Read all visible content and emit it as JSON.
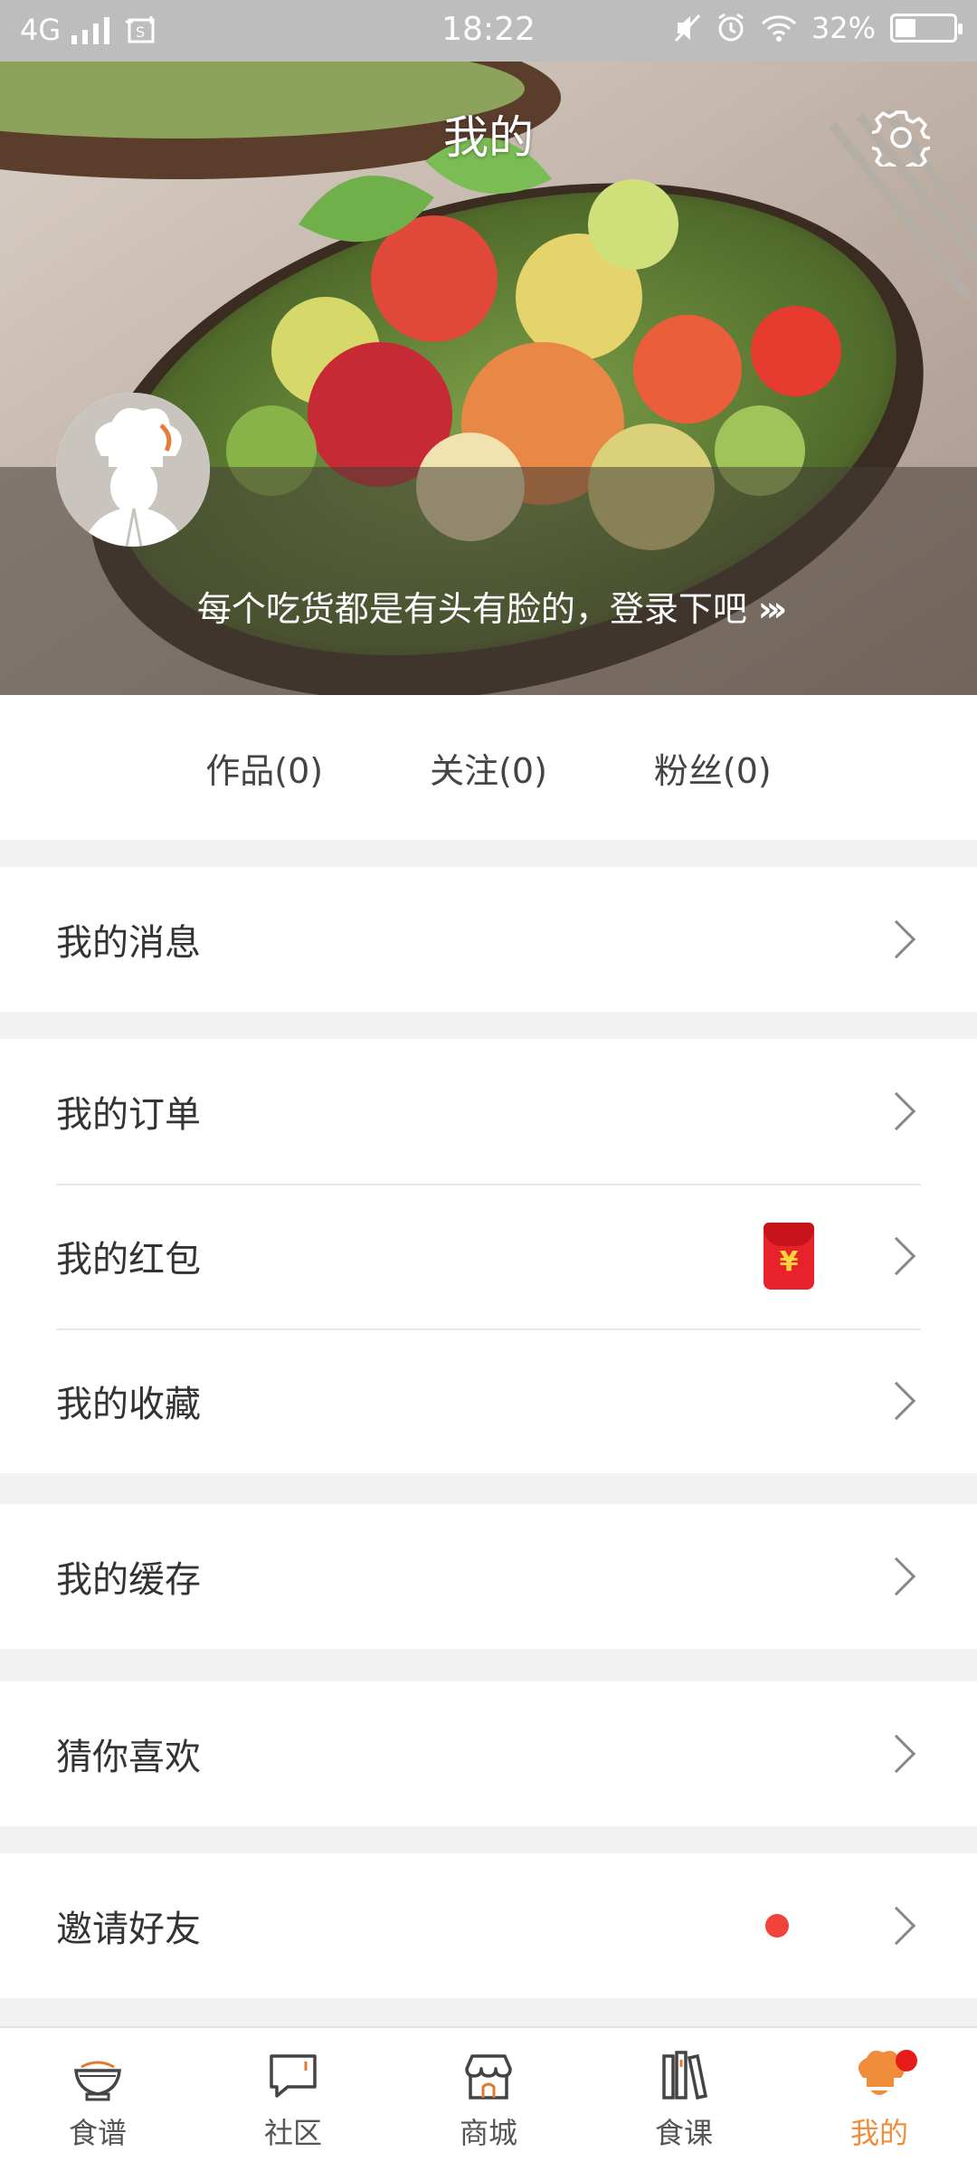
{
  "status_bar": {
    "network": "4G",
    "time": "18:22",
    "battery": "32%"
  },
  "header": {
    "title": "我的"
  },
  "profile": {
    "login_tip": "每个吃货都是有头有脸的，登录下吧",
    "login_arrow": "»›"
  },
  "stats": {
    "works": "作品(0)",
    "following": "关注(0)",
    "fans": "粉丝(0)"
  },
  "menu": {
    "messages": "我的消息",
    "orders": "我的订单",
    "red_packets": "我的红包",
    "red_packet_symbol": "¥",
    "favorites": "我的收藏",
    "cache": "我的缓存",
    "guess_like": "猜你喜欢",
    "invite": "邀请好友"
  },
  "tabbar": {
    "recipes": "食谱",
    "community": "社区",
    "mall": "商城",
    "courses": "食课",
    "mine": "我的"
  },
  "colors": {
    "accent": "#f08d3b",
    "badge_red": "#e81b1b",
    "dot_red": "#f0433a"
  }
}
